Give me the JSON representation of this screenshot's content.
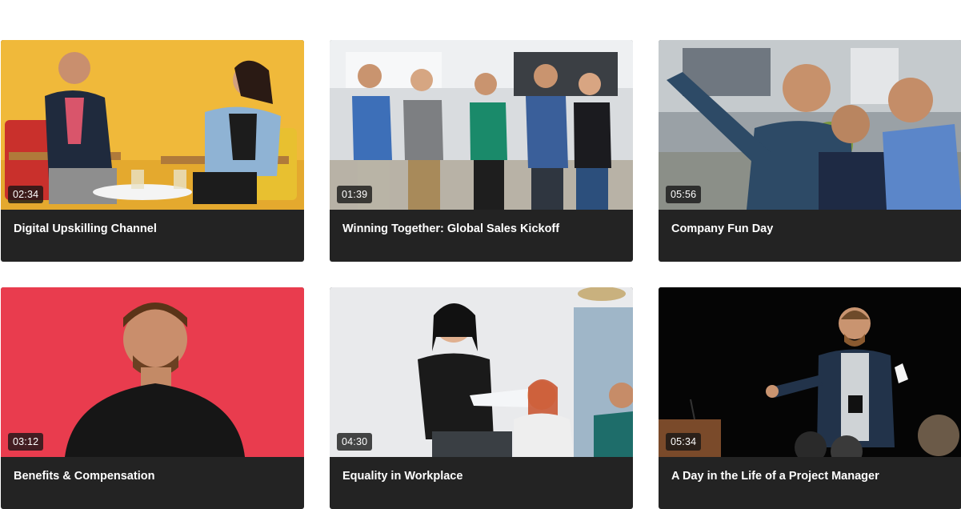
{
  "videos": [
    {
      "title": "Digital Upskilling Channel",
      "duration": "02:34",
      "thumbnail": "two-people-talking-in-chairs"
    },
    {
      "title": "Winning Together: Global Sales Kickoff",
      "duration": "01:39",
      "thumbnail": "team-standing-in-office"
    },
    {
      "title": "Company Fun Day",
      "duration": "05:56",
      "thumbnail": "three-men-taking-selfie"
    },
    {
      "title": "Benefits & Compensation",
      "duration": "03:12",
      "thumbnail": "man-on-red-background"
    },
    {
      "title": "Equality in Workplace",
      "duration": "04:30",
      "thumbnail": "woman-presenting-to-audience"
    },
    {
      "title": "A Day in the Life of a Project Manager",
      "duration": "05:34",
      "thumbnail": "man-speaking-on-stage"
    }
  ],
  "colors": {
    "card_background": "#232323",
    "title_text": "#ffffff",
    "duration_badge": "#141414"
  }
}
